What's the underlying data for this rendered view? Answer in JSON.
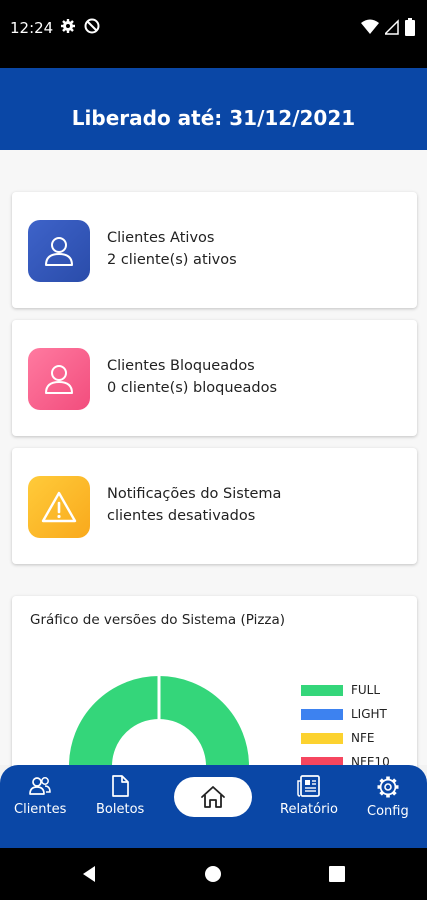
{
  "status_bar": {
    "time": "12:24"
  },
  "header": {
    "title": "Liberado até: 31/12/2021"
  },
  "cards": [
    {
      "line1": "Clientes Ativos",
      "line2": "2 cliente(s) ativos",
      "icon": "person-icon",
      "color": "#2f53b6"
    },
    {
      "line1": "Clientes Bloqueados",
      "line2": "0 cliente(s) bloqueados",
      "icon": "person-icon",
      "color": "#f65d88"
    },
    {
      "line1": "Notificações do Sistema",
      "line2": "clientes desativados",
      "icon": "warning-icon",
      "color": "#fbb82b"
    }
  ],
  "chart": {
    "title": "Gráfico de versões do Sistema (Pizza)"
  },
  "chart_data": {
    "type": "pie",
    "title": "Gráfico de versões do Sistema (Pizza)",
    "donut": true,
    "categories": [
      "FULL",
      "LIGHT",
      "NFE",
      "NFE10"
    ],
    "values": [
      100,
      0,
      0,
      0
    ],
    "colors": [
      "#34d67a",
      "#3d82f0",
      "#fcd22f",
      "#f6465f"
    ],
    "legend_position": "right"
  },
  "bottom_nav": {
    "items": [
      {
        "label": "Clientes",
        "icon": "people-icon"
      },
      {
        "label": "Boletos",
        "icon": "document-icon"
      },
      {
        "label": "",
        "icon": "home-icon"
      },
      {
        "label": "Relatório",
        "icon": "newspaper-icon"
      },
      {
        "label": "Config",
        "icon": "gear-icon"
      }
    ]
  }
}
